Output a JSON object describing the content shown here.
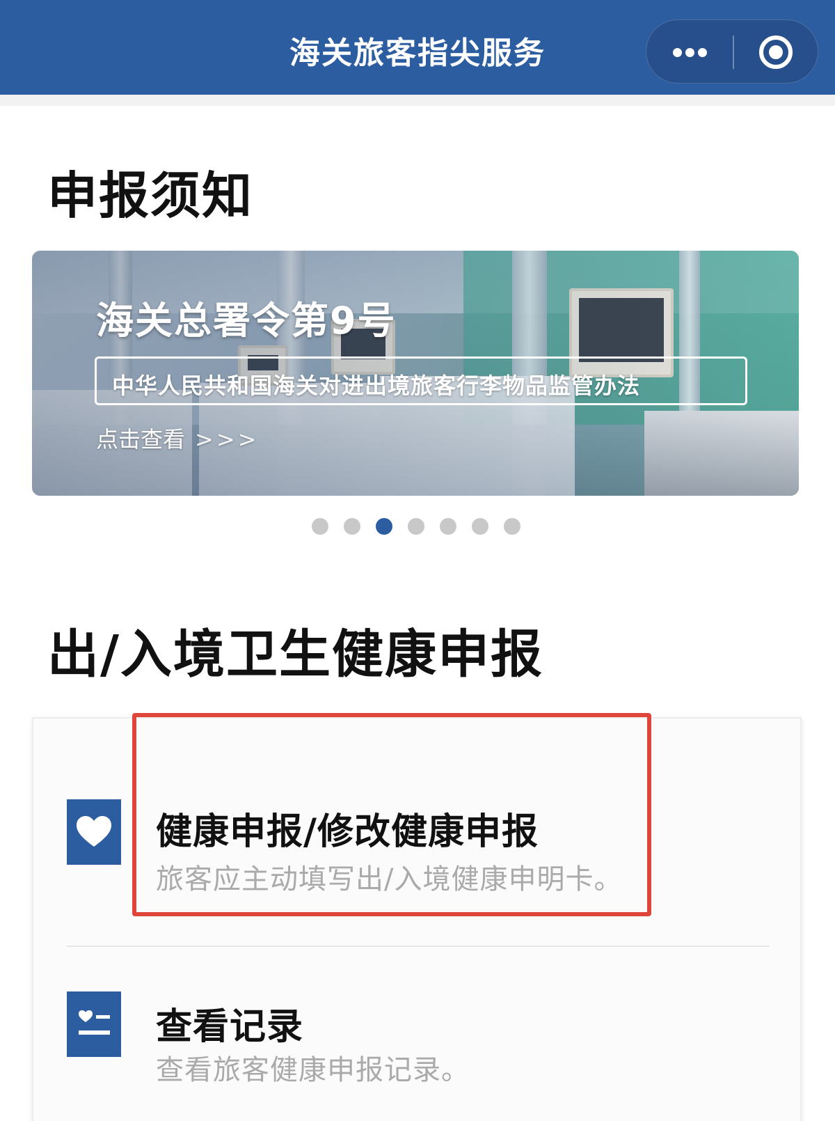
{
  "header": {
    "title": "海关旅客指尖服务",
    "more_icon": "more-dots-icon",
    "close_icon": "target-circle-icon",
    "bg_color": "#2d5da1"
  },
  "notice_section": {
    "title": "申报须知"
  },
  "banner": {
    "heading": "海关总署令第9号",
    "subtitle": "中华人民共和国海关对进出境旅客行李物品监管办法",
    "link_text": "点击查看",
    "link_arrows": ">>>"
  },
  "carousel": {
    "total": 7,
    "active_index": 2
  },
  "health_section": {
    "title": "出/入境卫生健康申报",
    "items": [
      {
        "label": "健康申报/修改健康申报",
        "description": "旅客应主动填写出/入境健康申明卡。",
        "icon": "heart-icon"
      },
      {
        "label": "查看记录",
        "description": "查看旅客健康申报记录。",
        "icon": "health-record-icon"
      }
    ]
  },
  "colors": {
    "accent": "#2d5da1",
    "highlight": "#e0453a",
    "muted_text": "#aaaaaa"
  }
}
